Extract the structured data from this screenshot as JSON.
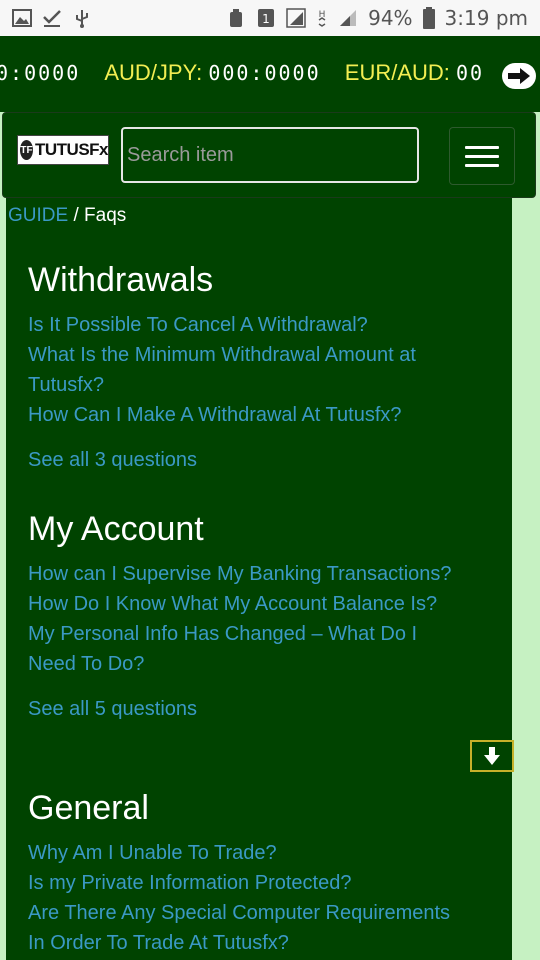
{
  "status_bar": {
    "battery": "94%",
    "time": "3:19 pm",
    "sim_badge": "1",
    "network_h": "H"
  },
  "ticker": {
    "items": [
      {
        "pair": "",
        "value": "0:0000"
      },
      {
        "pair": "AUD/JPY:",
        "value": "000:0000"
      },
      {
        "pair": "EUR/AUD:",
        "value": "00"
      }
    ]
  },
  "header": {
    "logo_text": "TUTUSFx",
    "logo_mark": "TF",
    "search_placeholder": "Search item"
  },
  "breadcrumb": {
    "link": "GUIDE",
    "separator": " / ",
    "current": "Faqs"
  },
  "sections": [
    {
      "title": "Withdrawals",
      "questions": [
        "Is It Possible To Cancel A Withdrawal?",
        "What Is the Minimum Withdrawal Amount at Tutusfx?",
        "How Can I Make A Withdrawal At Tutusfx?"
      ],
      "see_all": "See all 3 questions"
    },
    {
      "title": "My Account",
      "questions": [
        "How can I Supervise My Banking Transactions?",
        "How Do I Know What My Account Balance Is?",
        "My Personal Info Has Changed – What Do I Need To Do?"
      ],
      "see_all": "See all 5 questions"
    },
    {
      "title": "General",
      "questions": [
        "Why Am I Unable To Trade?",
        "Is my Private Information Protected?",
        "Are There Any Special Computer Requirements In Order To Trade At Tutusfx?"
      ],
      "see_all": ""
    }
  ],
  "colors": {
    "dark_green": "#004300",
    "light_green": "#c6f1c2",
    "link_blue": "#3b99c5",
    "ticker_yellow": "#f3ee52"
  }
}
